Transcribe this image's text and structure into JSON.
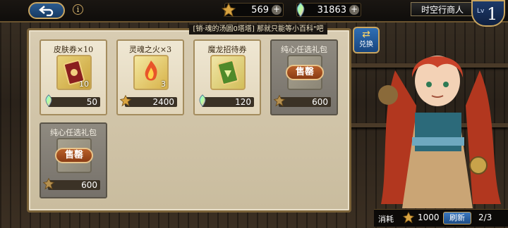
{
  "topbar": {
    "back_label": "back",
    "currencies": [
      {
        "name": "gold-leaf",
        "value": "569",
        "icon": "gold-leaf-icon"
      },
      {
        "name": "rainbow-crystal",
        "value": "31863",
        "icon": "rainbow-crystal-icon"
      }
    ],
    "merchant_name": "时空行商人",
    "level_prefix": "Lv",
    "level": "1"
  },
  "banner": "[销·魂的汤圆0塔塔] 那就只能等小百科\"吧",
  "exchange_label": "兑换",
  "cards": [
    {
      "title": "皮肤券×10",
      "qty": "10",
      "price": "50",
      "currency_icon": "rainbow-crystal-icon",
      "sold_out": false,
      "item_icon": "skin-ticket-icon"
    },
    {
      "title": "灵魂之火×3",
      "qty": "3",
      "price": "2400",
      "currency_icon": "gold-leaf-icon",
      "sold_out": false,
      "item_icon": "soul-fire-icon"
    },
    {
      "title": "魔龙招待券",
      "qty": "",
      "price": "120",
      "currency_icon": "rainbow-crystal-icon",
      "sold_out": false,
      "item_icon": "dragon-ticket-icon"
    },
    {
      "title": "纯心任选礼包",
      "qty": "",
      "price": "600",
      "currency_icon": "gold-leaf-icon",
      "sold_out": true,
      "item_icon": "gift-pack-icon"
    },
    {
      "title": "纯心任选礼包",
      "qty": "",
      "price": "600",
      "currency_icon": "gold-leaf-icon",
      "sold_out": true,
      "item_icon": "gift-pack-icon"
    }
  ],
  "sold_out_label": "售罄",
  "footer": {
    "cost_label": "消耗",
    "cost_value": "1000",
    "refresh_label": "刷新",
    "refresh_count": "2/3"
  },
  "colors": {
    "accent_gold": "#c9a560",
    "panel": "#d8ccb2",
    "button_blue": "#2f6fb5"
  }
}
